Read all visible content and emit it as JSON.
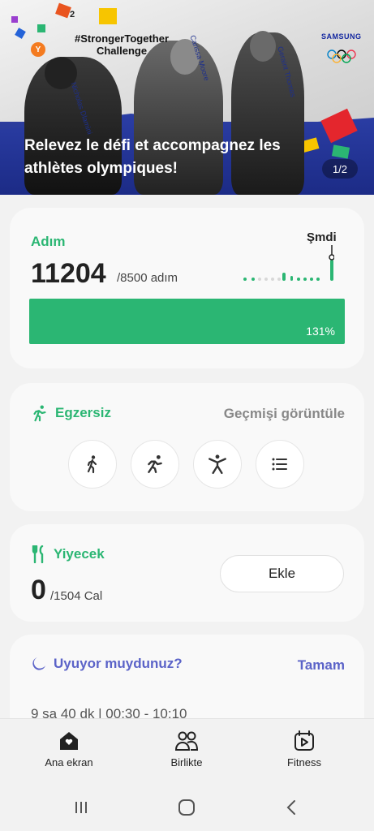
{
  "banner": {
    "badge": "Y",
    "confetti_count": "2",
    "hashtag_line1": "#StrongerTogether",
    "hashtag_line2": "Challenge",
    "athlete_names": [
      "Nicholas Dlamini",
      "Carissa Moore",
      "Geraint Thomas"
    ],
    "sponsor": "SAMSUNG",
    "headline": "Relevez le défi et accompagnez les athlètes olympiques!",
    "pager": "1/2",
    "colors": {
      "blue": "#1f2f8c",
      "red": "#e4262d",
      "yellow": "#f7c500"
    }
  },
  "steps": {
    "title": "Adım",
    "count": "11204",
    "goal": "/8500 adım",
    "now_label": "Şmdi",
    "progress_label": "131%",
    "progress_fraction": 1.0,
    "accent": "#2bb673"
  },
  "exercise": {
    "title": "Egzersiz",
    "history_link": "Geçmişi görüntüle",
    "buttons": [
      "walking-icon",
      "running-icon",
      "workout-icon",
      "list-icon"
    ]
  },
  "food": {
    "title": "Yiyecek",
    "count": "0",
    "goal": "/1504 Cal",
    "add_label": "Ekle"
  },
  "sleep": {
    "title": "Uyuyor muydunuz?",
    "done_label": "Tamam",
    "summary": "9 sa 40 dk | 00:30 - 10:10",
    "accent": "#5b63c8"
  },
  "nav": {
    "items": [
      {
        "label": "Ana ekran",
        "icon": "home-icon"
      },
      {
        "label": "Birlikte",
        "icon": "people-icon"
      },
      {
        "label": "Fitness",
        "icon": "fitness-icon"
      }
    ]
  },
  "system": {
    "buttons": [
      "recents-icon",
      "home-circle-icon",
      "back-icon"
    ]
  }
}
